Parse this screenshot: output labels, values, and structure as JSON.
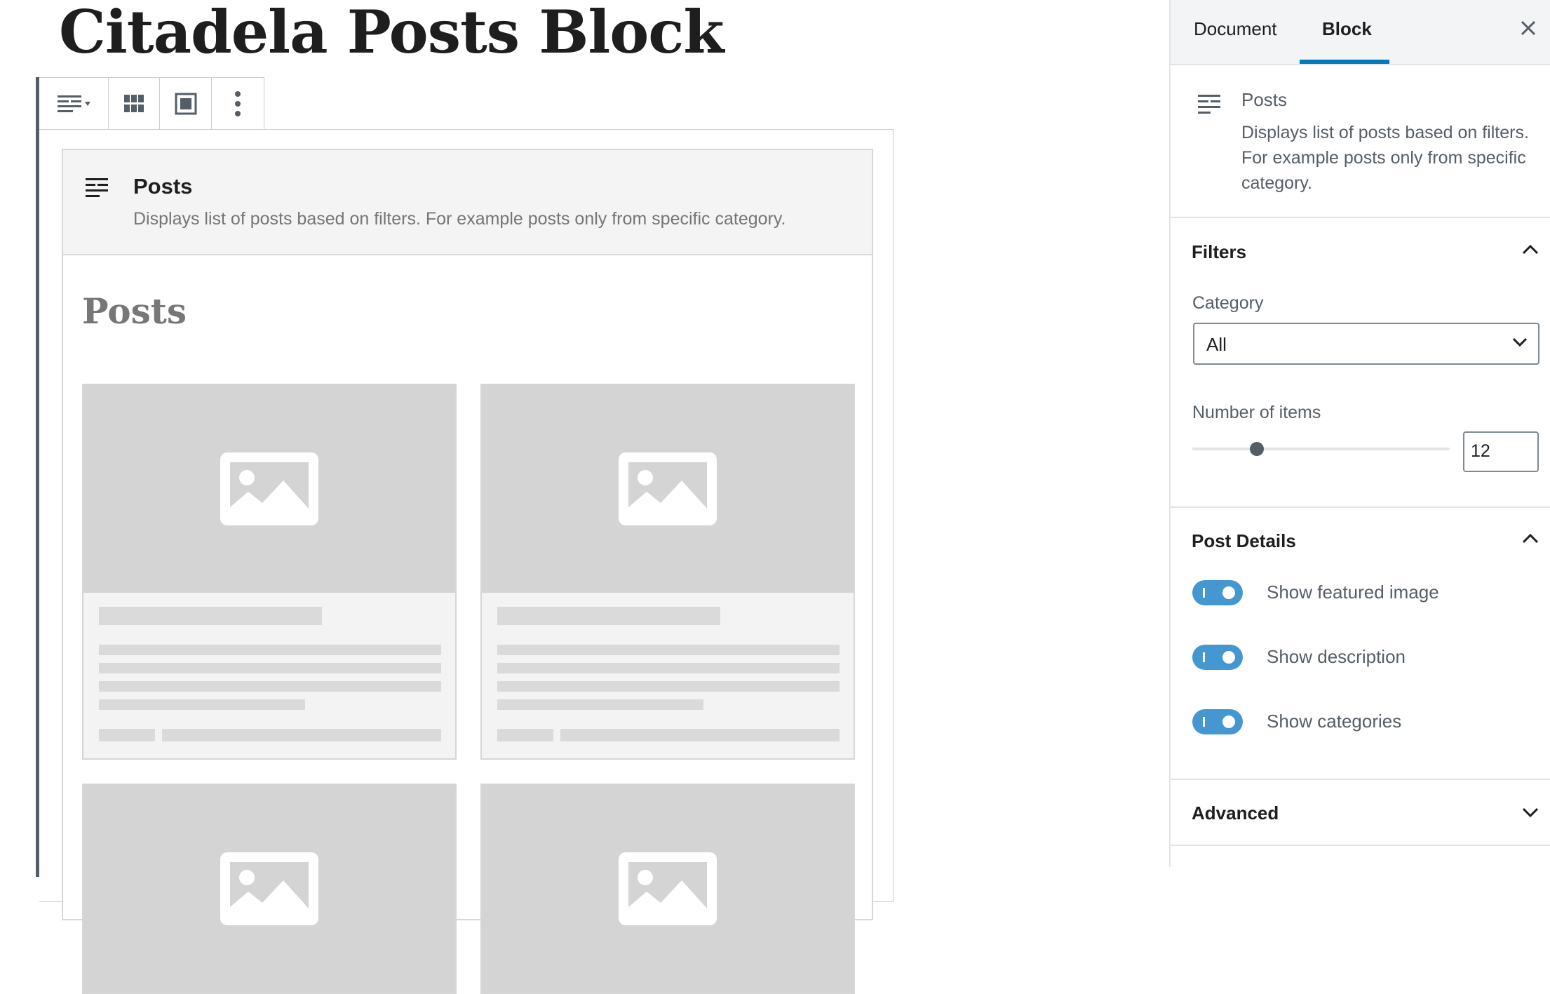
{
  "editor": {
    "page_title": "Citadela Posts Block",
    "placeholder": {
      "title": "Posts",
      "description": "Displays list of posts based on filters. For example posts only from specific category.",
      "heading": "Posts"
    }
  },
  "sidebar": {
    "tabs": [
      {
        "label": "Document",
        "active": false
      },
      {
        "label": "Block",
        "active": true
      }
    ],
    "close_icon": "close-icon",
    "block_card": {
      "title": "Posts",
      "description": "Displays list of posts based on filters. For example posts only from specific category."
    },
    "filters": {
      "title": "Filters",
      "expanded": true,
      "category_label": "Category",
      "category_value": "All",
      "number_label": "Number of items",
      "number_value": "12",
      "slider_fraction": 0.25
    },
    "post_details": {
      "title": "Post Details",
      "expanded": true,
      "toggles": [
        {
          "label": "Show featured image",
          "on": true
        },
        {
          "label": "Show description",
          "on": true
        },
        {
          "label": "Show categories",
          "on": true
        }
      ]
    },
    "advanced": {
      "title": "Advanced",
      "expanded": false
    }
  },
  "colors": {
    "accent": "#007cba",
    "toggle_on": "#4597d2",
    "placeholder_gray": "#d4d4d4"
  }
}
